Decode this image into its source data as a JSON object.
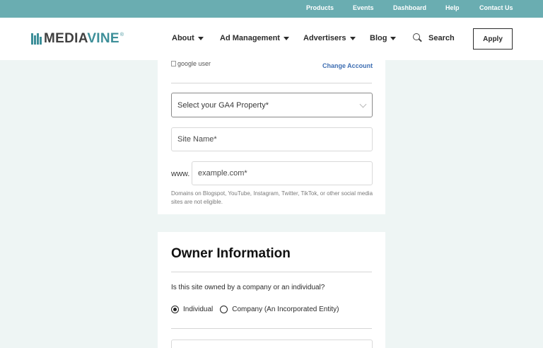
{
  "topbar": {
    "links": [
      "Products",
      "Events",
      "Dashboard",
      "Help",
      "Contact Us"
    ],
    "bg_color": "#6aadb1"
  },
  "header": {
    "logo_prefix": "MEDIA",
    "logo_suffix": "VINE",
    "logo_reg": "®",
    "nav": [
      {
        "label": "About"
      },
      {
        "label": "Ad Management"
      },
      {
        "label": "Advertisers"
      },
      {
        "label": "Blog"
      }
    ],
    "search_label": "Search",
    "apply_label": "Apply",
    "brand_color": "#3d8f99"
  },
  "account": {
    "avatar_alt": "google user",
    "change_label": "Change Account",
    "link_color": "#3f6fb3"
  },
  "form": {
    "ga4_placeholder": "Select your GA4 Property*",
    "site_name_placeholder": "Site Name*",
    "domain_prefix": "www.",
    "domain_placeholder": "example.com*",
    "domain_help": "Domains on Blogspot, YouTube, Instagram, Twitter, TikTok, or other social media sites are not eligible."
  },
  "owner": {
    "title": "Owner Information",
    "question": "Is this site owned by a company or an individual?",
    "options": [
      {
        "label": "Individual",
        "selected": true
      },
      {
        "label": "Company (An Incorporated Entity)",
        "selected": false
      }
    ]
  },
  "colors": {
    "page_bg": "#eef5f4"
  }
}
